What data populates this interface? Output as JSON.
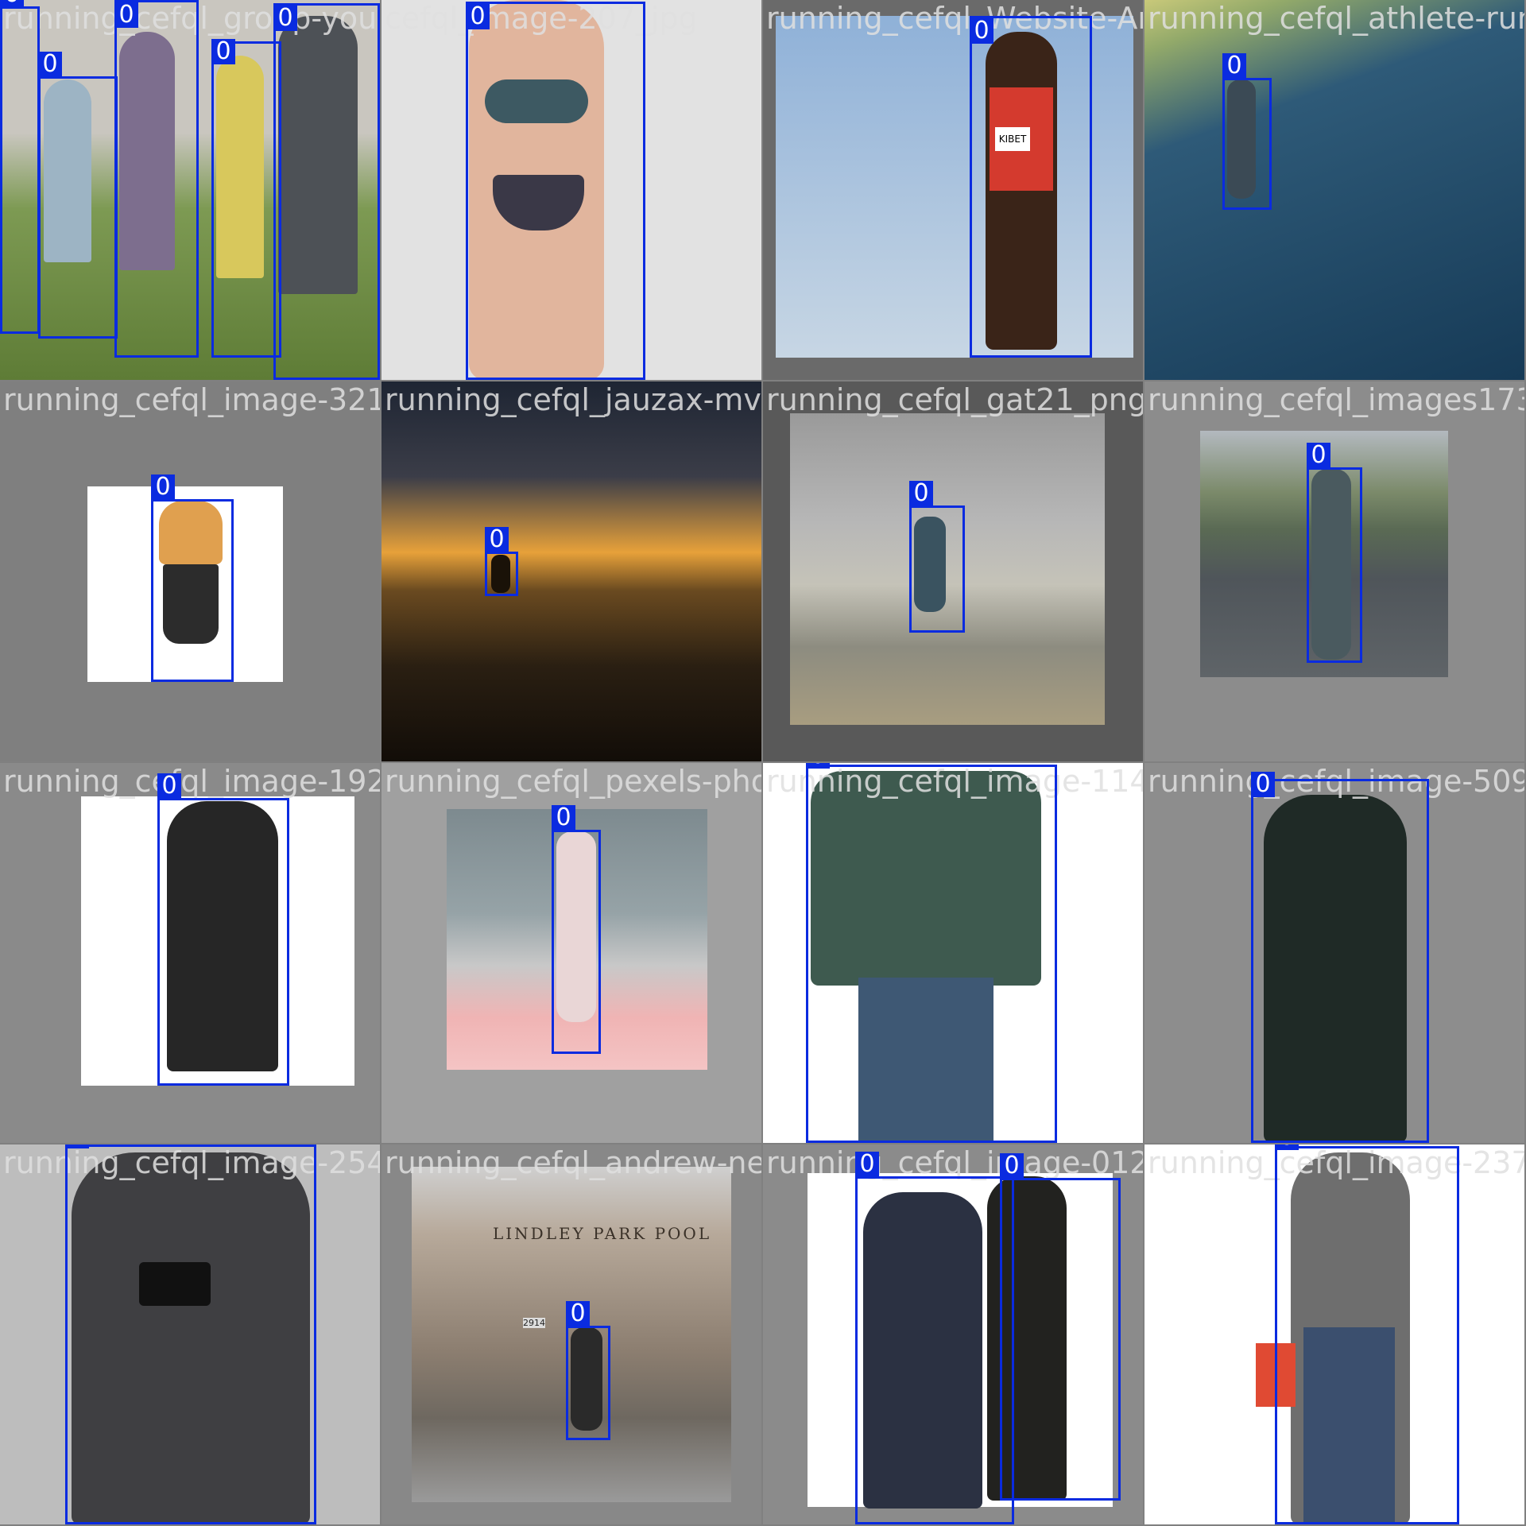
{
  "class_label": "0",
  "box_color": "#0a2be0",
  "tiles": [
    {
      "file": "running_cefql_group-young-",
      "bg": "#6b8a45"
    },
    {
      "file": "cefql_image-207_jpg",
      "bg": "#e2e2e2"
    },
    {
      "file": "running_cefql_Website-Article-Banner",
      "bg": "#9bb8d8"
    },
    {
      "file": "running_cefql_athlete-running",
      "bg": "#1f4766"
    },
    {
      "file": "running_cefql_image-3211_jpg",
      "bg": "#7f7f7f"
    },
    {
      "file": "running_cefql_jauzax-mvOZKquU0Q",
      "bg": "#2a2a30"
    },
    {
      "file": "running_cefql_gat21_png",
      "bg": "#595959"
    },
    {
      "file": "running_cefql_images173_jpg",
      "bg": "#8c8c8c"
    },
    {
      "file": "running_cefql_image-1927_jpg",
      "bg": "#8a8a8a"
    },
    {
      "file": "running_cefql_pexels-photo-2567038",
      "bg": "#a0a0a0"
    },
    {
      "file": "running_cefql_image-114_jpg",
      "bg": "#ffffff"
    },
    {
      "file": "running_cefql_image-509_jpg",
      "bg": "#8d8d8d"
    },
    {
      "file": "running_cefql_image-2542_jpg",
      "bg": "#bdbdbd"
    },
    {
      "file": "running_cefql_andrew-neel-4dFikh",
      "bg": "#888888"
    },
    {
      "file": "running_cefql_image-012_jpg",
      "bg": "#8b8b8b"
    },
    {
      "file": "running_cefql_image-2376_jpg",
      "bg": "#ffffff"
    }
  ],
  "pool_sign": "LINDLEY PARK POOL",
  "bib_text": "KIBET",
  "door_number": "2914"
}
